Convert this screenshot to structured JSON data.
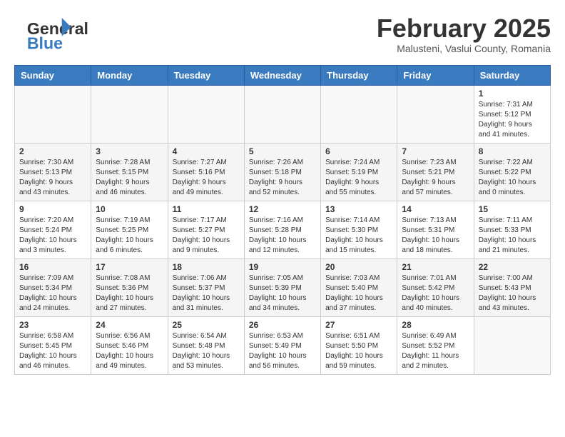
{
  "header": {
    "logo_general": "General",
    "logo_blue": "Blue",
    "month_title": "February 2025",
    "location": "Malusteni, Vaslui County, Romania"
  },
  "weekdays": [
    "Sunday",
    "Monday",
    "Tuesday",
    "Wednesday",
    "Thursday",
    "Friday",
    "Saturday"
  ],
  "weeks": [
    [
      {
        "day": "",
        "info": ""
      },
      {
        "day": "",
        "info": ""
      },
      {
        "day": "",
        "info": ""
      },
      {
        "day": "",
        "info": ""
      },
      {
        "day": "",
        "info": ""
      },
      {
        "day": "",
        "info": ""
      },
      {
        "day": "1",
        "info": "Sunrise: 7:31 AM\nSunset: 5:12 PM\nDaylight: 9 hours\nand 41 minutes."
      }
    ],
    [
      {
        "day": "2",
        "info": "Sunrise: 7:30 AM\nSunset: 5:13 PM\nDaylight: 9 hours\nand 43 minutes."
      },
      {
        "day": "3",
        "info": "Sunrise: 7:28 AM\nSunset: 5:15 PM\nDaylight: 9 hours\nand 46 minutes."
      },
      {
        "day": "4",
        "info": "Sunrise: 7:27 AM\nSunset: 5:16 PM\nDaylight: 9 hours\nand 49 minutes."
      },
      {
        "day": "5",
        "info": "Sunrise: 7:26 AM\nSunset: 5:18 PM\nDaylight: 9 hours\nand 52 minutes."
      },
      {
        "day": "6",
        "info": "Sunrise: 7:24 AM\nSunset: 5:19 PM\nDaylight: 9 hours\nand 55 minutes."
      },
      {
        "day": "7",
        "info": "Sunrise: 7:23 AM\nSunset: 5:21 PM\nDaylight: 9 hours\nand 57 minutes."
      },
      {
        "day": "8",
        "info": "Sunrise: 7:22 AM\nSunset: 5:22 PM\nDaylight: 10 hours\nand 0 minutes."
      }
    ],
    [
      {
        "day": "9",
        "info": "Sunrise: 7:20 AM\nSunset: 5:24 PM\nDaylight: 10 hours\nand 3 minutes."
      },
      {
        "day": "10",
        "info": "Sunrise: 7:19 AM\nSunset: 5:25 PM\nDaylight: 10 hours\nand 6 minutes."
      },
      {
        "day": "11",
        "info": "Sunrise: 7:17 AM\nSunset: 5:27 PM\nDaylight: 10 hours\nand 9 minutes."
      },
      {
        "day": "12",
        "info": "Sunrise: 7:16 AM\nSunset: 5:28 PM\nDaylight: 10 hours\nand 12 minutes."
      },
      {
        "day": "13",
        "info": "Sunrise: 7:14 AM\nSunset: 5:30 PM\nDaylight: 10 hours\nand 15 minutes."
      },
      {
        "day": "14",
        "info": "Sunrise: 7:13 AM\nSunset: 5:31 PM\nDaylight: 10 hours\nand 18 minutes."
      },
      {
        "day": "15",
        "info": "Sunrise: 7:11 AM\nSunset: 5:33 PM\nDaylight: 10 hours\nand 21 minutes."
      }
    ],
    [
      {
        "day": "16",
        "info": "Sunrise: 7:09 AM\nSunset: 5:34 PM\nDaylight: 10 hours\nand 24 minutes."
      },
      {
        "day": "17",
        "info": "Sunrise: 7:08 AM\nSunset: 5:36 PM\nDaylight: 10 hours\nand 27 minutes."
      },
      {
        "day": "18",
        "info": "Sunrise: 7:06 AM\nSunset: 5:37 PM\nDaylight: 10 hours\nand 31 minutes."
      },
      {
        "day": "19",
        "info": "Sunrise: 7:05 AM\nSunset: 5:39 PM\nDaylight: 10 hours\nand 34 minutes."
      },
      {
        "day": "20",
        "info": "Sunrise: 7:03 AM\nSunset: 5:40 PM\nDaylight: 10 hours\nand 37 minutes."
      },
      {
        "day": "21",
        "info": "Sunrise: 7:01 AM\nSunset: 5:42 PM\nDaylight: 10 hours\nand 40 minutes."
      },
      {
        "day": "22",
        "info": "Sunrise: 7:00 AM\nSunset: 5:43 PM\nDaylight: 10 hours\nand 43 minutes."
      }
    ],
    [
      {
        "day": "23",
        "info": "Sunrise: 6:58 AM\nSunset: 5:45 PM\nDaylight: 10 hours\nand 46 minutes."
      },
      {
        "day": "24",
        "info": "Sunrise: 6:56 AM\nSunset: 5:46 PM\nDaylight: 10 hours\nand 49 minutes."
      },
      {
        "day": "25",
        "info": "Sunrise: 6:54 AM\nSunset: 5:48 PM\nDaylight: 10 hours\nand 53 minutes."
      },
      {
        "day": "26",
        "info": "Sunrise: 6:53 AM\nSunset: 5:49 PM\nDaylight: 10 hours\nand 56 minutes."
      },
      {
        "day": "27",
        "info": "Sunrise: 6:51 AM\nSunset: 5:50 PM\nDaylight: 10 hours\nand 59 minutes."
      },
      {
        "day": "28",
        "info": "Sunrise: 6:49 AM\nSunset: 5:52 PM\nDaylight: 11 hours\nand 2 minutes."
      },
      {
        "day": "",
        "info": ""
      }
    ]
  ]
}
